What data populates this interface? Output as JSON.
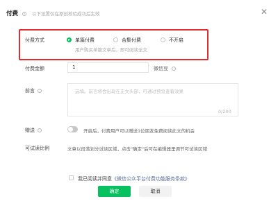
{
  "dialog": {
    "title": "付费",
    "subtitle": "以下设置仅在原创校验成功后生效",
    "close_icon": "close-icon"
  },
  "payment_method": {
    "label": "付费方式",
    "options": [
      {
        "label": "单篇付费",
        "selected": true
      },
      {
        "label": "合集付费",
        "selected": false
      },
      {
        "label": "不开启",
        "selected": false
      }
    ],
    "hint": "用户购买单篇文章后，即可阅读全文"
  },
  "amount": {
    "label": "付费金额",
    "value": "1",
    "unit": "微信豆"
  },
  "preface": {
    "label": "前言",
    "placeholder": "选填。前言将会出现在正文头部，可通过预览查看效果",
    "counter": "0/200"
  },
  "gift": {
    "label": "赠送",
    "enabled": false,
    "text": "开启后，付费用户可以赠送1位朋友免费阅读此文的机会"
  },
  "trial_ratio": {
    "label": "可试读比例",
    "text": "文章以段落划分试读区域，点击\"确定\"后可在编辑器里调节可试读区域"
  },
  "agreement": {
    "prefix": "我已阅读并同意",
    "link": "《微信公众平台付费功能服务条款》",
    "checked": false
  },
  "buttons": {
    "confirm": "确定",
    "cancel": "取消"
  },
  "colors": {
    "accent": "#07c160",
    "highlight_border": "#e02e2e",
    "link": "#576b95"
  }
}
